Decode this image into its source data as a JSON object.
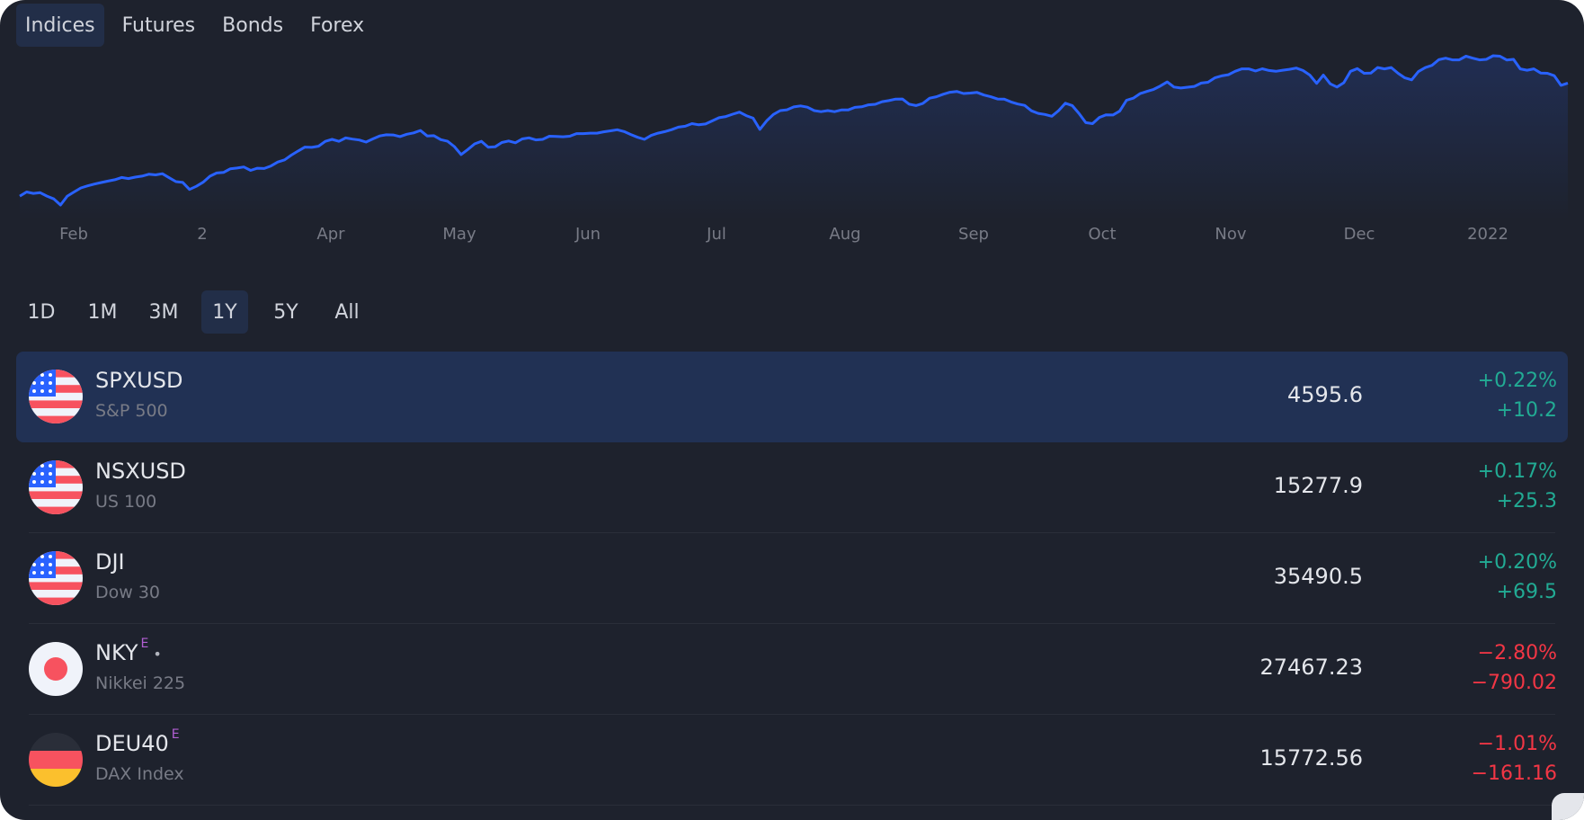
{
  "market_tabs": [
    "Indices",
    "Futures",
    "Bonds",
    "Forex"
  ],
  "active_market_tab": "Indices",
  "range_tabs": [
    "1D",
    "1M",
    "3M",
    "1Y",
    "5Y",
    "All"
  ],
  "active_range_tab": "1Y",
  "colors": {
    "background": "#1e222d",
    "accent": "#2962ff",
    "positive": "#22ab94",
    "negative": "#f23645",
    "selected_row": "#213154",
    "extended_hours_marker": "#b25fd3"
  },
  "chart_data": {
    "type": "area",
    "x_tick_labels": [
      "Feb",
      "2",
      "Apr",
      "May",
      "Jun",
      "Jul",
      "Aug",
      "Sep",
      "Oct",
      "Nov",
      "Dec",
      "2022"
    ],
    "y_axis_visible": false,
    "grid": false,
    "series": [
      {
        "values": [
          3770,
          3800,
          3790,
          3795,
          3770,
          3750,
          3705,
          3770,
          3800,
          3830,
          3845,
          3858,
          3869,
          3880,
          3890,
          3906,
          3898,
          3909,
          3916,
          3930,
          3925,
          3934,
          3904,
          3876,
          3870,
          3819,
          3842,
          3871,
          3915,
          3939,
          3943,
          3969,
          3975,
          3983,
          3958,
          3974,
          3972,
          3990,
          4019,
          4035,
          4070,
          4100,
          4128,
          4126,
          4135,
          4170,
          4185,
          4170,
          4195,
          4187,
          4180,
          4165,
          4188,
          4210,
          4218,
          4217,
          4205,
          4222,
          4232,
          4250,
          4210,
          4212,
          4183,
          4171,
          4132,
          4074,
          4111,
          4152,
          4170,
          4127,
          4130,
          4162,
          4173,
          4160,
          4188,
          4196,
          4181,
          4185,
          4208,
          4206,
          4204,
          4208,
          4227,
          4227,
          4230,
          4230,
          4240,
          4247,
          4255,
          4242,
          4220,
          4200,
          4185,
          4214,
          4230,
          4241,
          4256,
          4274,
          4281,
          4300,
          4291,
          4297,
          4320,
          4343,
          4352,
          4369,
          4384,
          4358,
          4340,
          4258,
          4320,
          4367,
          4395,
          4401,
          4422,
          4429,
          4420,
          4395,
          4387,
          4395,
          4387,
          4400,
          4400,
          4419,
          4423,
          4437,
          4441,
          4460,
          4468,
          4479,
          4480,
          4442,
          4432,
          4447,
          4486,
          4496,
          4515,
          4529,
          4535,
          4520,
          4523,
          4528,
          4509,
          4496,
          4480,
          4479,
          4458,
          4443,
          4433,
          4394,
          4375,
          4367,
          4354,
          4395,
          4449,
          4432,
          4375,
          4307,
          4300,
          4345,
          4364,
          4363,
          4391,
          4471,
          4486,
          4519,
          4535,
          4550,
          4575,
          4605,
          4567,
          4560,
          4566,
          4572,
          4596,
          4602,
          4634,
          4649,
          4657,
          4682,
          4700,
          4700,
          4685,
          4701,
          4688,
          4682,
          4690,
          4697,
          4706,
          4688,
          4655,
          4594,
          4655,
          4591,
          4567,
          4599,
          4682,
          4702,
          4668,
          4670,
          4710,
          4700,
          4710,
          4668,
          4634,
          4620,
          4680,
          4709,
          4726,
          4767,
          4778,
          4766,
          4766,
          4793,
          4778,
          4766,
          4770,
          4796,
          4793,
          4765,
          4770,
          4700,
          4690,
          4700,
          4670,
          4668,
          4650,
          4580,
          4596
        ]
      }
    ]
  },
  "symbols": [
    {
      "ticker": "SPXUSD",
      "name": "S&P 500",
      "price": "4595.6",
      "change_pct": "+0.22%",
      "change_abs": "+10.2",
      "direction": "pos",
      "flag": "us-flag-icon",
      "extended": "",
      "dot": "",
      "selected": true
    },
    {
      "ticker": "NSXUSD",
      "name": "US 100",
      "price": "15277.9",
      "change_pct": "+0.17%",
      "change_abs": "+25.3",
      "direction": "pos",
      "flag": "us-flag-icon",
      "extended": "",
      "dot": "",
      "selected": false
    },
    {
      "ticker": "DJI",
      "name": "Dow 30",
      "price": "35490.5",
      "change_pct": "+0.20%",
      "change_abs": "+69.5",
      "direction": "pos",
      "flag": "us-flag-icon",
      "extended": "",
      "dot": "",
      "selected": false
    },
    {
      "ticker": "NKY",
      "name": "Nikkei 225",
      "price": "27467.23",
      "change_pct": "−2.80%",
      "change_abs": "−790.02",
      "direction": "neg",
      "flag": "japan-flag-icon",
      "extended": "E",
      "dot": "•",
      "selected": false
    },
    {
      "ticker": "DEU40",
      "name": "DAX Index",
      "price": "15772.56",
      "change_pct": "−1.01%",
      "change_abs": "−161.16",
      "direction": "neg",
      "flag": "germany-flag-icon",
      "extended": "E",
      "dot": "",
      "selected": false
    }
  ]
}
